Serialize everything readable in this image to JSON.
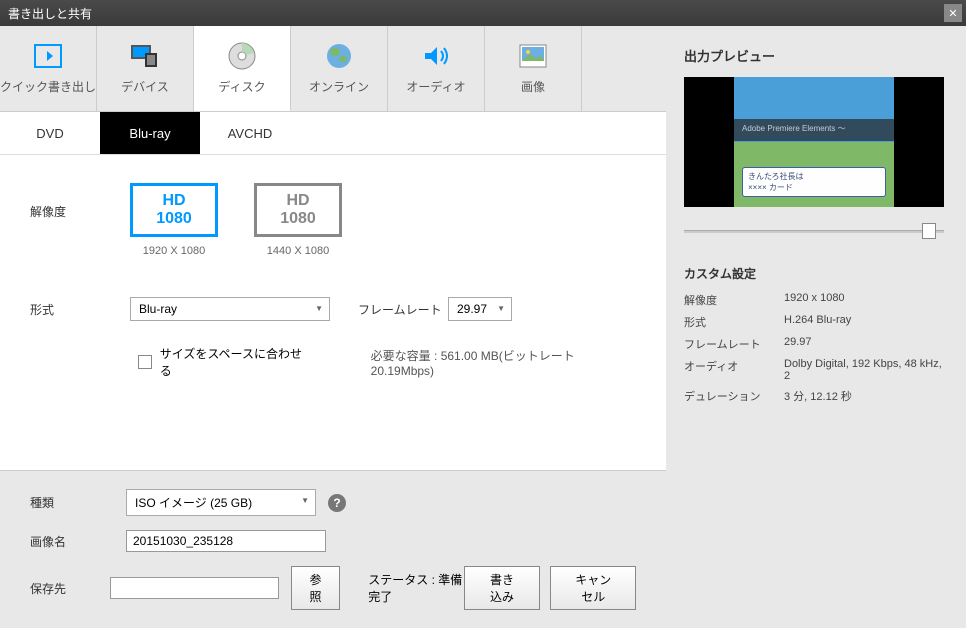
{
  "window": {
    "title": "書き出しと共有"
  },
  "tabs": {
    "quick": "クイック書き出し",
    "device": "デバイス",
    "disk": "ディスク",
    "online": "オンライン",
    "audio": "オーディオ",
    "image": "画像"
  },
  "subtabs": {
    "dvd": "DVD",
    "bluray": "Blu-ray",
    "avchd": "AVCHD"
  },
  "labels": {
    "resolution": "解像度",
    "format": "形式",
    "framerate": "フレームレート",
    "fit": "サイズをスペースに合わせる",
    "required": "必要な容量 :",
    "required_value": "561.00 MB(ビットレート 20.19Mbps)",
    "type": "種類",
    "image_name": "画像名",
    "save_to": "保存先",
    "browse": "参照",
    "status_label": "ステータス :",
    "status_value": "準備完了",
    "write": "書き込み",
    "cancel": "キャンセル"
  },
  "resolution_options": [
    {
      "line1": "HD",
      "line2": "1080",
      "sub": "1920 X 1080",
      "selected": true
    },
    {
      "line1": "HD",
      "line2": "1080",
      "sub": "1440 X 1080",
      "selected": false
    }
  ],
  "format_value": "Blu-ray",
  "framerate_value": "29.97",
  "type_value": "ISO イメージ (25 GB)",
  "image_name_value": "20151030_235128",
  "save_to_value": "",
  "preview": {
    "title": "出力プレビュー",
    "adobe_text": "Adobe Premiere Elements ～",
    "game_text1": "きんたろ社長は",
    "game_text2": "×××× カード"
  },
  "custom": {
    "title": "カスタム設定",
    "rows": [
      {
        "label": "解像度",
        "value": "1920 x 1080"
      },
      {
        "label": "形式",
        "value": "H.264 Blu-ray"
      },
      {
        "label": "フレームレート",
        "value": "29.97"
      },
      {
        "label": "オーディオ",
        "value": "Dolby Digital, 192 Kbps, 48 kHz, 2"
      },
      {
        "label": "デュレーション",
        "value": "3 分, 12.12 秒"
      }
    ]
  }
}
